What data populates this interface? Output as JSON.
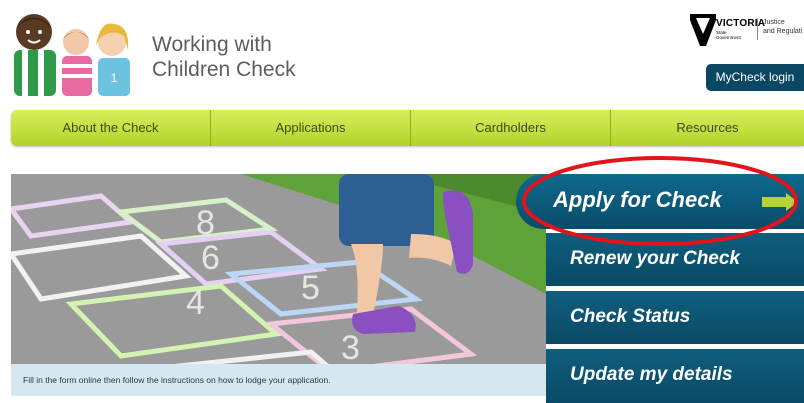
{
  "header": {
    "site_title_line1": "Working with",
    "site_title_line2": "Children Check",
    "gov_wordmark": "VICTORIA",
    "gov_sub_line1": "State",
    "gov_sub_line2": "Government",
    "gov_department_line1": "Justice",
    "gov_department_line2": "and Regulati",
    "mycheck_label": "MyCheck login"
  },
  "nav": {
    "items": [
      {
        "label": "About the Check"
      },
      {
        "label": "Applications"
      },
      {
        "label": "Cardholders"
      },
      {
        "label": "Resources"
      }
    ]
  },
  "hero": {
    "caption": "Fill in the form online then follow the instructions on how to lodge your application."
  },
  "actions": {
    "apply": "Apply for Check",
    "renew": "Renew your Check",
    "status": "Check Status",
    "update": "Update my details"
  },
  "colors": {
    "nav_green": "#c4e03f",
    "action_blue": "#0b5171",
    "highlight_red": "#e0141b",
    "arrow_green": "#b5d334"
  }
}
